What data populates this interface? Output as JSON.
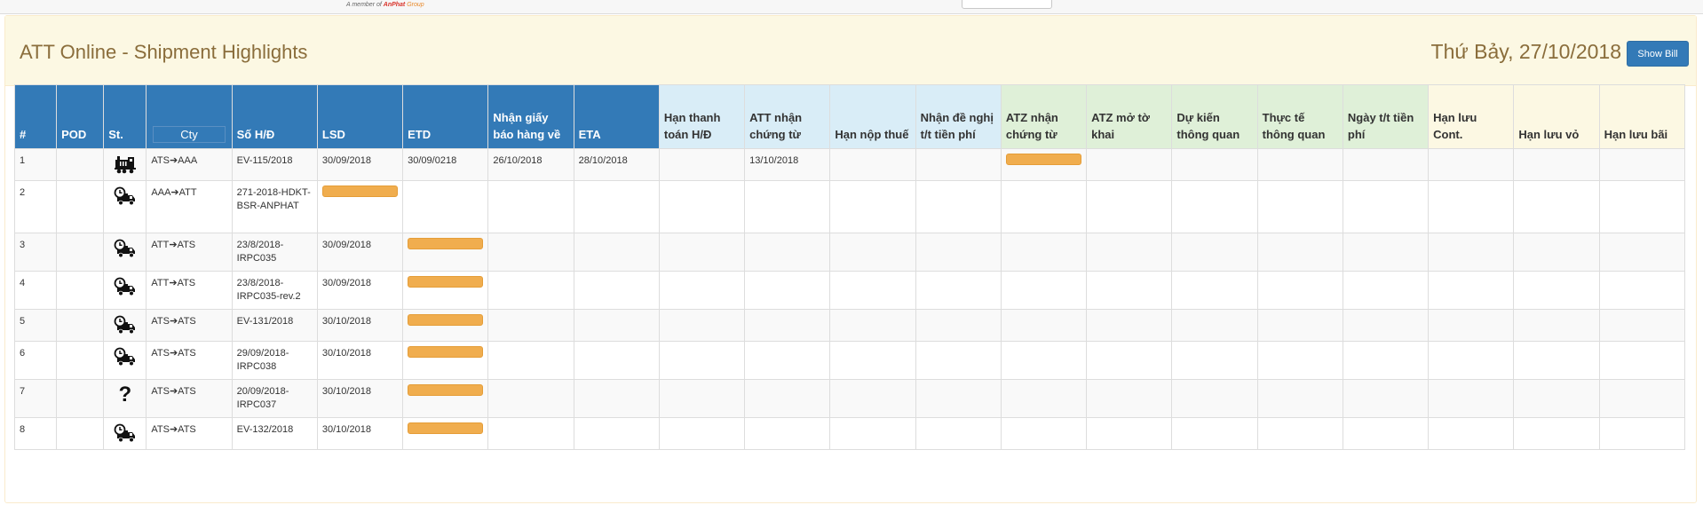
{
  "topbar": {
    "tagline_prefix": "A member of ",
    "tagline_brand": "AnPhat",
    "tagline_suffix": " Group"
  },
  "header": {
    "title": "ATT Online - Shipment Highlights",
    "date": "Thứ Bảy, 27/10/2018",
    "show_bill_label": "Show Bill"
  },
  "columns": [
    {
      "key": "no",
      "label": "#"
    },
    {
      "key": "pod",
      "label": "POD"
    },
    {
      "key": "st",
      "label": "St."
    },
    {
      "key": "cty",
      "label": "Cty"
    },
    {
      "key": "so_hd",
      "label": "Số H/Đ"
    },
    {
      "key": "lsd",
      "label": "LSD"
    },
    {
      "key": "etd",
      "label": "ETD"
    },
    {
      "key": "nhan_giay",
      "label": "Nhận giấy báo hàng về"
    },
    {
      "key": "eta",
      "label": "ETA"
    },
    {
      "key": "han_tt",
      "label": "Hạn thanh toán H/Đ"
    },
    {
      "key": "att_nhan",
      "label": "ATT nhận chứng từ"
    },
    {
      "key": "han_nop",
      "label": "Hạn nộp thuế"
    },
    {
      "key": "nhan_de_nghi",
      "label": "Nhận đề nghị t/t tiền phí"
    },
    {
      "key": "atz_nhan",
      "label": "ATZ nhận chứng từ"
    },
    {
      "key": "atz_mo",
      "label": "ATZ mở tờ khai"
    },
    {
      "key": "du_kien",
      "label": "Dự kiến thông quan"
    },
    {
      "key": "thuc_te",
      "label": "Thực tế thông quan"
    },
    {
      "key": "ngay_tt",
      "label": "Ngày t/t tiền phí"
    },
    {
      "key": "han_cont",
      "label": "Hạn lưu Cont."
    },
    {
      "key": "han_vo",
      "label": "Hạn lưu vỏ"
    },
    {
      "key": "han_bai",
      "label": "Hạn lưu bãi"
    }
  ],
  "rows": [
    {
      "no": "1",
      "pod": "",
      "st_icon": "train-icon",
      "cty": "ATS➔AAA",
      "so_hd": "EV-115/2018",
      "lsd": "30/09/2018",
      "etd": "30/09/0218",
      "nhan_giay": "26/10/2018",
      "eta": "28/10/2018",
      "han_tt": "",
      "att_nhan": "13/10/2018",
      "han_nop": "",
      "nhan_de_nghi": "",
      "atz_nhan": "bar",
      "atz_mo": "",
      "du_kien": "",
      "thuc_te": "",
      "ngay_tt": "",
      "han_cont": "",
      "han_vo": "",
      "han_bai": ""
    },
    {
      "no": "2",
      "pod": "",
      "st_icon": "truck-clock-icon",
      "cty": "AAA➔ATT",
      "so_hd": "271-2018-HDKT-BSR-ANPHAT",
      "lsd": "bar",
      "etd": "",
      "nhan_giay": "",
      "eta": "",
      "han_tt": "",
      "att_nhan": "",
      "han_nop": "",
      "nhan_de_nghi": "",
      "atz_nhan": "",
      "atz_mo": "",
      "du_kien": "",
      "thuc_te": "",
      "ngay_tt": "",
      "han_cont": "",
      "han_vo": "",
      "han_bai": ""
    },
    {
      "no": "3",
      "pod": "",
      "st_icon": "truck-clock-icon",
      "cty": "ATT➔ATS",
      "so_hd": "23/8/2018-IRPC035",
      "lsd": "30/09/2018",
      "etd": "bar",
      "nhan_giay": "",
      "eta": "",
      "han_tt": "",
      "att_nhan": "",
      "han_nop": "",
      "nhan_de_nghi": "",
      "atz_nhan": "",
      "atz_mo": "",
      "du_kien": "",
      "thuc_te": "",
      "ngay_tt": "",
      "han_cont": "",
      "han_vo": "",
      "han_bai": ""
    },
    {
      "no": "4",
      "pod": "",
      "st_icon": "truck-clock-icon",
      "cty": "ATT➔ATS",
      "so_hd": "23/8/2018-IRPC035-rev.2",
      "lsd": "30/09/2018",
      "etd": "bar",
      "nhan_giay": "",
      "eta": "",
      "han_tt": "",
      "att_nhan": "",
      "han_nop": "",
      "nhan_de_nghi": "",
      "atz_nhan": "",
      "atz_mo": "",
      "du_kien": "",
      "thuc_te": "",
      "ngay_tt": "",
      "han_cont": "",
      "han_vo": "",
      "han_bai": ""
    },
    {
      "no": "5",
      "pod": "",
      "st_icon": "truck-clock-icon",
      "cty": "ATS➔ATS",
      "so_hd": "EV-131/2018",
      "lsd": "30/10/2018",
      "etd": "bar",
      "nhan_giay": "",
      "eta": "",
      "han_tt": "",
      "att_nhan": "",
      "han_nop": "",
      "nhan_de_nghi": "",
      "atz_nhan": "",
      "atz_mo": "",
      "du_kien": "",
      "thuc_te": "",
      "ngay_tt": "",
      "han_cont": "",
      "han_vo": "",
      "han_bai": ""
    },
    {
      "no": "6",
      "pod": "",
      "st_icon": "truck-clock-icon",
      "cty": "ATS➔ATS",
      "so_hd": "29/09/2018-IRPC038",
      "lsd": "30/10/2018",
      "etd": "bar",
      "nhan_giay": "",
      "eta": "",
      "han_tt": "",
      "att_nhan": "",
      "han_nop": "",
      "nhan_de_nghi": "",
      "atz_nhan": "",
      "atz_mo": "",
      "du_kien": "",
      "thuc_te": "",
      "ngay_tt": "",
      "han_cont": "",
      "han_vo": "",
      "han_bai": ""
    },
    {
      "no": "7",
      "pod": "",
      "st_icon": "question-icon",
      "cty": "ATS➔ATS",
      "so_hd": "20/09/2018-IRPC037",
      "lsd": "30/10/2018",
      "etd": "bar",
      "nhan_giay": "",
      "eta": "",
      "han_tt": "",
      "att_nhan": "",
      "han_nop": "",
      "nhan_de_nghi": "",
      "atz_nhan": "",
      "atz_mo": "",
      "du_kien": "",
      "thuc_te": "",
      "ngay_tt": "",
      "han_cont": "",
      "han_vo": "",
      "han_bai": ""
    },
    {
      "no": "8",
      "pod": "",
      "st_icon": "truck-clock-icon",
      "cty": "ATS➔ATS",
      "so_hd": "EV-132/2018",
      "lsd": "30/10/2018",
      "etd": "bar",
      "nhan_giay": "",
      "eta": "",
      "han_tt": "",
      "att_nhan": "",
      "han_nop": "",
      "nhan_de_nghi": "",
      "atz_nhan": "",
      "atz_mo": "",
      "du_kien": "",
      "thuc_te": "",
      "ngay_tt": "",
      "han_cont": "",
      "han_vo": "",
      "han_bai": ""
    }
  ],
  "colors": {
    "primary": "#337ab7",
    "info": "#d9edf7",
    "success": "#dff0d8",
    "warning": "#fcf8e3",
    "bar": "#f0ad4e",
    "title_text": "#8a6d3b"
  }
}
